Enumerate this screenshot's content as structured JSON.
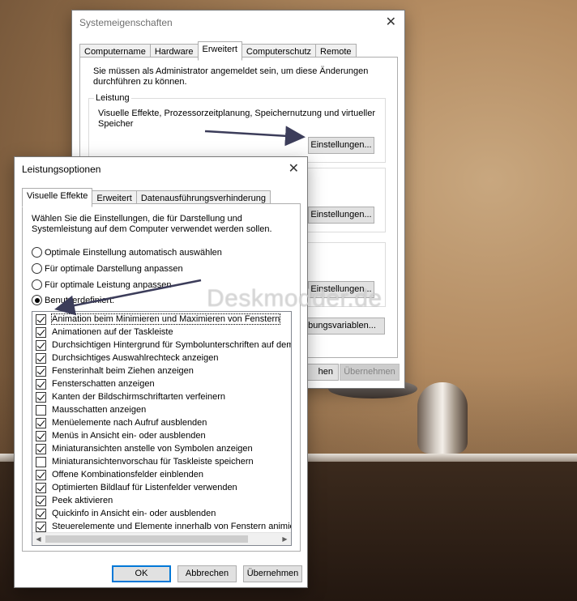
{
  "sys": {
    "title": "Systemeigenschaften",
    "tabs": [
      "Computername",
      "Hardware",
      "Erweitert",
      "Computerschutz",
      "Remote"
    ],
    "admin_note_1": "Sie müssen als Administrator angemeldet sein, um diese Änderungen",
    "admin_note_2": "durchführen zu können.",
    "group_leistung": "Leistung",
    "leistung_desc_1": "Visuelle Effekte, Prozessorzeitplanung, Speichernutzung und virtueller",
    "leistung_desc_2": "Speicher",
    "einstellungen_1": "Einstellungen...",
    "einstellungen_2": "Einstellungen...",
    "einstellungen_3": "Einstellungen...",
    "umgebungsvariablen": "bungsvariablen...",
    "ok_partial": "hen",
    "uebernehmen": "Übernehmen"
  },
  "perf": {
    "title": "Leistungsoptionen",
    "tabs": [
      "Visuelle Effekte",
      "Erweitert",
      "Datenausführungsverhinderung"
    ],
    "intro_1": "Wählen Sie die Einstellungen, die für Darstellung und",
    "intro_2": "Systemleistung auf dem Computer verwendet werden sollen.",
    "radios": [
      {
        "label": "Optimale Einstellung automatisch auswählen",
        "on": false
      },
      {
        "label": "Für optimale Darstellung anpassen",
        "on": false
      },
      {
        "label": "Für optimale Leistung anpassen",
        "on": false
      },
      {
        "label": "Benutzerdefiniert:",
        "on": true
      }
    ],
    "items": [
      {
        "label": "Animation beim Minimieren und Maximieren von Fenstern",
        "on": true
      },
      {
        "label": "Animationen auf der Taskleiste",
        "on": true
      },
      {
        "label": "Durchsichtigen Hintergrund für Symbolunterschriften auf dem",
        "on": true
      },
      {
        "label": "Durchsichtiges Auswahlrechteck anzeigen",
        "on": true
      },
      {
        "label": "Fensterinhalt beim Ziehen anzeigen",
        "on": true
      },
      {
        "label": "Fensterschatten anzeigen",
        "on": true
      },
      {
        "label": "Kanten der Bildschirmschriftarten verfeinern",
        "on": true
      },
      {
        "label": "Mausschatten anzeigen",
        "on": false
      },
      {
        "label": "Menüelemente nach Aufruf ausblenden",
        "on": true
      },
      {
        "label": "Menüs in Ansicht ein- oder ausblenden",
        "on": true
      },
      {
        "label": "Miniaturansichten anstelle von Symbolen anzeigen",
        "on": true
      },
      {
        "label": "Miniaturansichtenvorschau für Taskleiste speichern",
        "on": false
      },
      {
        "label": "Offene Kombinationsfelder einblenden",
        "on": true
      },
      {
        "label": "Optimierten Bildlauf für Listenfelder verwenden",
        "on": true
      },
      {
        "label": "Peek aktivieren",
        "on": true
      },
      {
        "label": "Quickinfo in Ansicht ein- oder ausblenden",
        "on": true
      },
      {
        "label": "Steuerelemente und Elemente innerhalb von Fenstern animier",
        "on": true
      }
    ],
    "ok": "OK",
    "cancel": "Abbrechen",
    "apply": "Übernehmen"
  },
  "watermark": "Deskmodder.de",
  "colors": {
    "accent": "#0078d7",
    "arrow": "#3c3d5a"
  }
}
